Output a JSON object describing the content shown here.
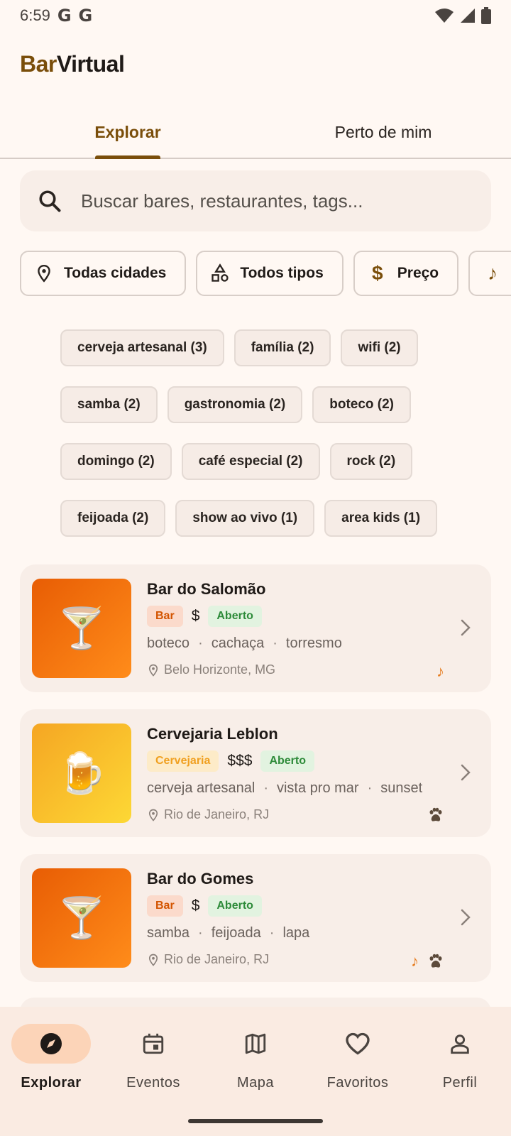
{
  "status": {
    "time": "6:59",
    "g1": "G",
    "g2": "G"
  },
  "app": {
    "brand": "Bar",
    "rest": "Virtual"
  },
  "tabs": [
    {
      "label": "Explorar",
      "active": true
    },
    {
      "label": "Perto de mim",
      "active": false
    }
  ],
  "search": {
    "placeholder": "Buscar bares, restaurantes, tags..."
  },
  "filters": [
    {
      "label": "Todas cidades",
      "icon": "location-pin-icon"
    },
    {
      "label": "Todos tipos",
      "icon": "category-icon"
    },
    {
      "label": "Preço",
      "icon": "dollar-icon"
    },
    {
      "label": "",
      "icon": "music-note-icon"
    }
  ],
  "tags": [
    [
      "cerveja artesanal (3)",
      "família (2)",
      "wifi (2)"
    ],
    [
      "samba (2)",
      "gastronomia (2)",
      "boteco (2)"
    ],
    [
      "domingo (2)",
      "café especial (2)",
      "rock (2)"
    ],
    [
      "feijoada (2)",
      "show ao vivo (1)",
      "area kids (1)"
    ]
  ],
  "places": [
    {
      "name": "Bar do Salomão",
      "type": "Bar",
      "price": "$",
      "status": "Aberto",
      "tags": [
        "boteco",
        "cachaça",
        "torresmo"
      ],
      "location": "Belo Horizonte, MG",
      "emoji": "🍸",
      "amenities": [
        "music"
      ]
    },
    {
      "name": "Cervejaria Leblon",
      "type": "Cervejaria",
      "price": "$$$",
      "status": "Aberto",
      "tags": [
        "cerveja artesanal",
        "vista pro mar",
        "sunset"
      ],
      "location": "Rio de Janeiro, RJ",
      "emoji": "🍺",
      "amenities": [
        "pet"
      ]
    },
    {
      "name": "Bar do Gomes",
      "type": "Bar",
      "price": "$",
      "status": "Aberto",
      "tags": [
        "samba",
        "feijoada",
        "lapa"
      ],
      "location": "Rio de Janeiro, RJ",
      "emoji": "🍸",
      "amenities": [
        "music",
        "pet"
      ]
    }
  ],
  "nav": [
    {
      "label": "Explorar",
      "icon": "compass-icon",
      "active": true
    },
    {
      "label": "Eventos",
      "icon": "calendar-icon",
      "active": false
    },
    {
      "label": "Mapa",
      "icon": "map-icon",
      "active": false
    },
    {
      "label": "Favoritos",
      "icon": "heart-icon",
      "active": false
    },
    {
      "label": "Perfil",
      "icon": "person-icon",
      "active": false
    }
  ],
  "colors": {
    "accent": "#7A4E0A",
    "background": "#FFF8F3",
    "open": "#2E8B3A",
    "orange": "#E67E22"
  }
}
